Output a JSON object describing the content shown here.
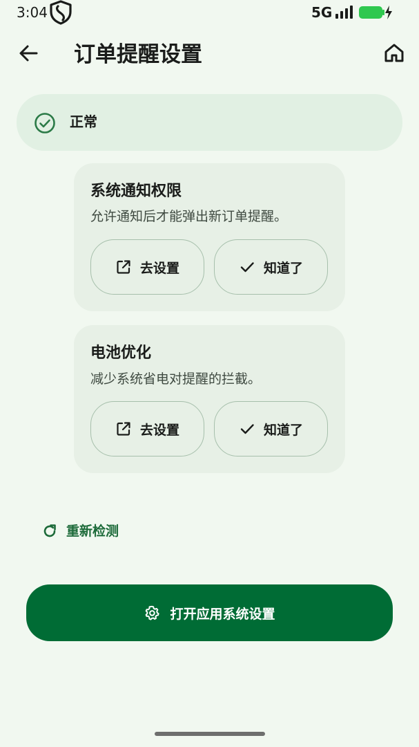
{
  "status_bar": {
    "time": "3:04",
    "network": "5G",
    "battery_color": "#2fc84f",
    "icons": [
      "shield-icon",
      "signal-icon",
      "battery-charging-icon"
    ]
  },
  "app_bar": {
    "title": "订单提醒设置",
    "back_icon": "arrow-left-icon",
    "home_icon": "home-icon"
  },
  "status": {
    "label": "正常",
    "icon": "check-circle-icon"
  },
  "cards": [
    {
      "title": "系统通知权限",
      "description": "允许通知后才能弹出新订单提醒。",
      "settings_label": "去设置",
      "ok_label": "知道了"
    },
    {
      "title": "电池优化",
      "description": "减少系统省电对提醒的拦截。",
      "settings_label": "去设置",
      "ok_label": "知道了"
    }
  ],
  "recheck": {
    "label": "重新检测",
    "icon": "refresh-icon"
  },
  "primary": {
    "label": "打开应用系统设置",
    "icon": "gear-icon"
  },
  "colors": {
    "background": "#f1f8f0",
    "accent": "#006c35",
    "accent_text": "#1c6a39",
    "card": "#e7f0e6",
    "banner": "#e1f0e3"
  }
}
